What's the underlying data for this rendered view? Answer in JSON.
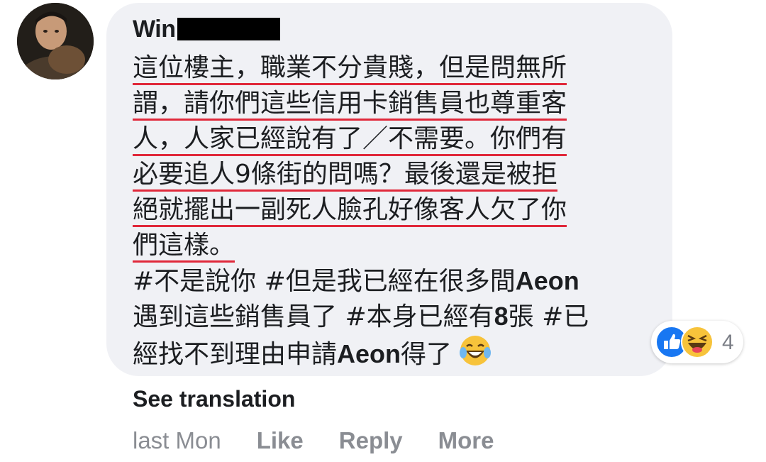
{
  "comment": {
    "author_visible": "Win",
    "lines": [
      "這位樓主，職業不分貴賤，但是問無所",
      "謂，請你們這些信用卡銷售員也尊重客",
      "人，人家已經說有了／不需要。你們有",
      "必要追人9條街的問嗎？最後還是被拒",
      "絕就擺出一副死人臉孔好像客人欠了你",
      "們這樣。"
    ],
    "hashtag_lines": [
      [
        "#不是說你 #但是我已經在很多間",
        "Aeon",
        ""
      ],
      [
        "遇到這些銷售員了 #本身已經有",
        "8",
        "張 #已"
      ],
      [
        "經找不到理由申請",
        "Aeon",
        "得了"
      ]
    ],
    "emoji": "laughing-tears-emoji"
  },
  "reactions": {
    "types": [
      "like-reaction-icon",
      "haha-reaction-icon"
    ],
    "count": "4"
  },
  "see_translation": "See translation",
  "actions": {
    "time": "last Mon",
    "like": "Like",
    "reply": "Reply",
    "more": "More"
  },
  "colors": {
    "bubble": "#f0f1f5",
    "underline": "#e0283a",
    "like_blue": "#1877f2",
    "haha_yellow": "#f7c33b",
    "meta_gray": "#8a8d93"
  }
}
